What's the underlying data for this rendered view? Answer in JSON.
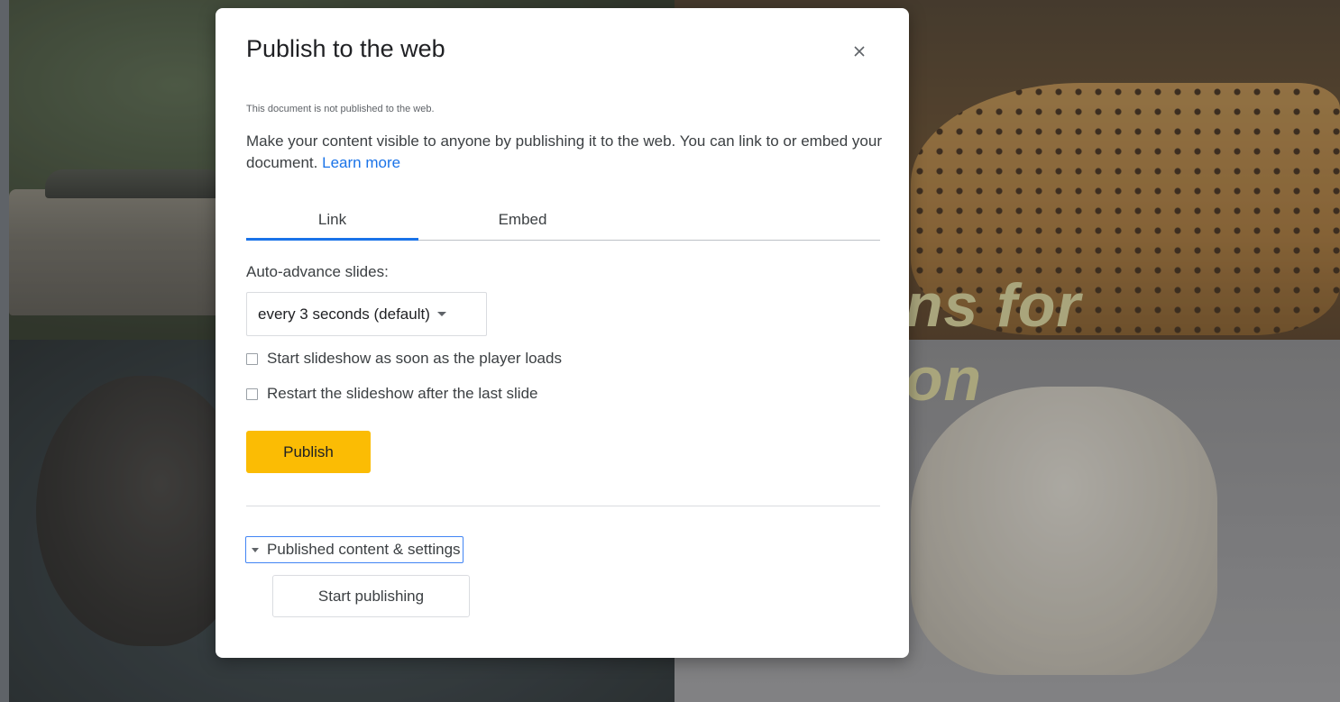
{
  "background": {
    "slide_title_fragment": "ns for\non"
  },
  "dialog": {
    "title": "Publish to the web",
    "close_icon": "close-icon",
    "status_note": "This document is not published to the web.",
    "description": "Make your content visible to anyone by publishing it to the web. You can link to or embed your document.",
    "learn_more": "Learn more",
    "tabs": [
      {
        "label": "Link",
        "selected": true
      },
      {
        "label": "Embed",
        "selected": false
      }
    ],
    "auto_advance": {
      "label": "Auto-advance slides:",
      "selected_option": "every 3 seconds (default)"
    },
    "checkboxes": [
      {
        "label": "Start slideshow as soon as the player loads",
        "checked": false
      },
      {
        "label": "Restart the slideshow after the last slide",
        "checked": false
      }
    ],
    "publish_button": "Publish",
    "published_settings": {
      "label": "Published content & settings",
      "start_publishing_button": "Start publishing"
    }
  },
  "colors": {
    "accent_blue": "#1a73e8",
    "publish_yellow": "#fbbc04"
  }
}
